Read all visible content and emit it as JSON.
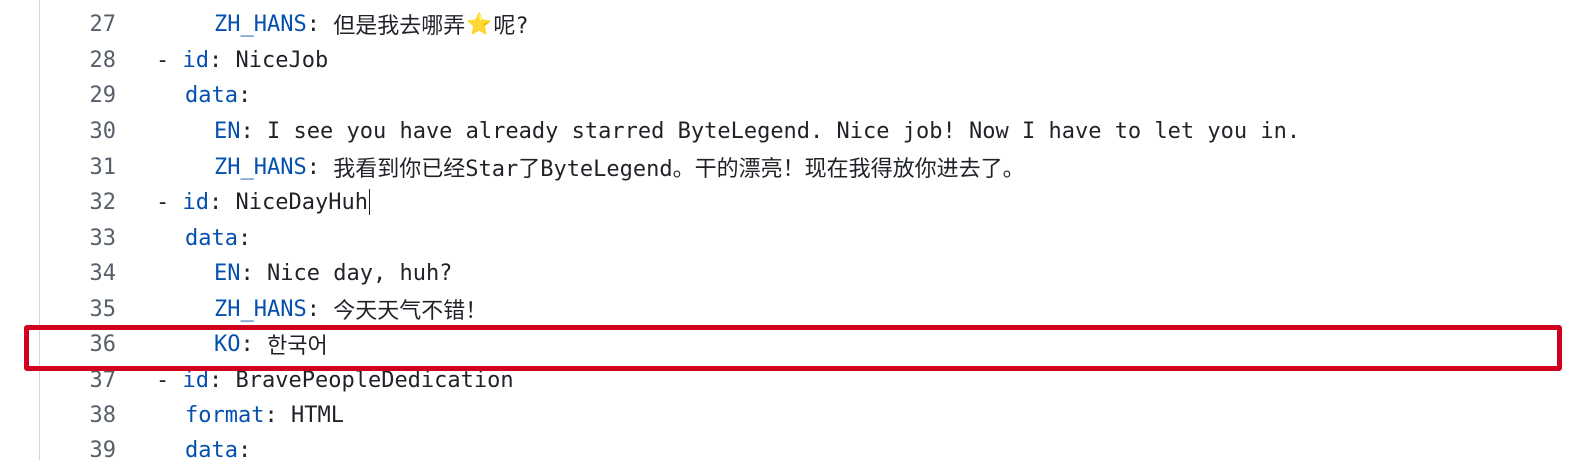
{
  "colors": {
    "key": "#0550ae",
    "line_number": "#57606a",
    "highlight_border": "#d1001f",
    "star": "#f4c430"
  },
  "lines": [
    {
      "num": "27",
      "dash": "",
      "key": "ZH_HANS",
      "sep": ": ",
      "value_before": "但是我去哪弄",
      "icon": "star-icon",
      "icon_glyph": "⭐",
      "value_after": "呢?"
    },
    {
      "num": "28",
      "dash": "- ",
      "key": "id",
      "sep": ": ",
      "value": "NiceJob"
    },
    {
      "num": "29",
      "dash": "",
      "key": "data",
      "sep": ":",
      "value": ""
    },
    {
      "num": "30",
      "dash": "",
      "key": "EN",
      "sep": ": ",
      "value": "I see you have already starred ByteLegend. Nice job! Now I have to let you in."
    },
    {
      "num": "31",
      "dash": "",
      "key": "ZH_HANS",
      "sep": ": ",
      "value": "我看到你已经Star了ByteLegend。干的漂亮！现在我得放你进去了。"
    },
    {
      "num": "32",
      "dash": "- ",
      "key": "id",
      "sep": ": ",
      "value": "NiceDayHuh"
    },
    {
      "num": "33",
      "dash": "",
      "key": "data",
      "sep": ":",
      "value": ""
    },
    {
      "num": "34",
      "dash": "",
      "key": "EN",
      "sep": ": ",
      "value": "Nice day, huh?"
    },
    {
      "num": "35",
      "dash": "",
      "key": "ZH_HANS",
      "sep": ": ",
      "value": "今天天气不错！"
    },
    {
      "num": "36",
      "dash": "",
      "key": "KO",
      "sep": ": ",
      "value": "한국어"
    },
    {
      "num": "37",
      "dash": "- ",
      "key": "id",
      "sep": ": ",
      "value": "BravePeopleDedication"
    },
    {
      "num": "38",
      "dash": "",
      "key": "format",
      "sep": ": ",
      "value": "HTML"
    },
    {
      "num": "39",
      "dash": "",
      "key": "data",
      "sep": ":",
      "value": ""
    }
  ]
}
